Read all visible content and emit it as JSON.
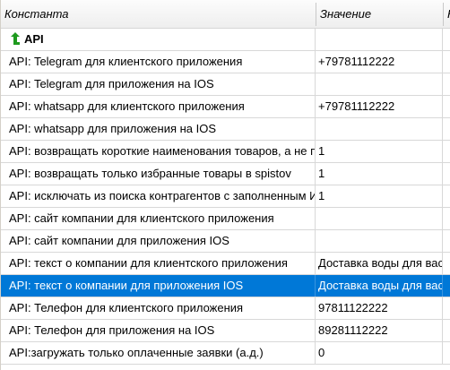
{
  "columns": {
    "constant": "Константа",
    "value": "Значение",
    "third": "К"
  },
  "group": {
    "label": "API",
    "icon": "green-up-arrow-icon"
  },
  "rows": [
    {
      "constant": "API: Telegram для клиентского приложения",
      "value": "+79781112222"
    },
    {
      "constant": "API: Telegram для приложения на IOS",
      "value": ""
    },
    {
      "constant": "API: whatsapp для клиентского приложения",
      "value": "+79781112222"
    },
    {
      "constant": "API: whatsapp для приложения на IOS",
      "value": ""
    },
    {
      "constant": "API: возвращать короткие наименования товаров, а не п",
      "value": "1"
    },
    {
      "constant": "API: возвращать только избранные товары в spistov",
      "value": "1"
    },
    {
      "constant": "API: исключать из поиска контрагентов с заполненным И",
      "value": "1"
    },
    {
      "constant": "API: сайт компании для клиентского приложения",
      "value": ""
    },
    {
      "constant": "API: сайт компании для приложения IOS",
      "value": ""
    },
    {
      "constant": "API: текст о компании для клиентского приложения",
      "value": "Доставка воды для вас"
    },
    {
      "constant": "API: текст о компании для приложения IOS",
      "value": "Доставка воды для вас",
      "selected": true
    },
    {
      "constant": "API: Телефон для клиентского приложения",
      "value": "97811122222"
    },
    {
      "constant": "API: Телефон для приложения на IOS",
      "value": "89281112222"
    },
    {
      "constant": "API:загружать только оплаченные заявки (а.д.)",
      "value": "0"
    }
  ],
  "colors": {
    "selection": "#0078d7",
    "arrow": "#1e9a1e",
    "grid_line": "#d8d8d8"
  }
}
